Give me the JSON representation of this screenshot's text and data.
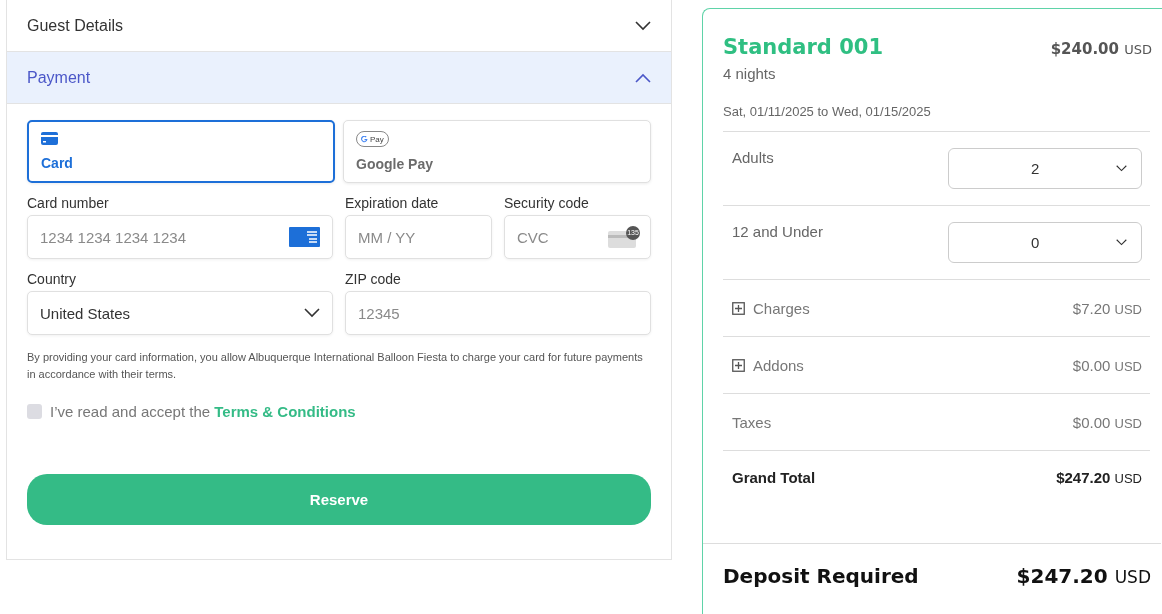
{
  "accordion": [
    {
      "title": "Guest Details",
      "expanded": false
    },
    {
      "title": "Payment",
      "expanded": true
    }
  ],
  "payment_methods": [
    {
      "label": "Card",
      "kind": "card",
      "selected": true
    },
    {
      "label": "Google Pay",
      "kind": "gpay",
      "logo_text": "Pay",
      "selected": false
    }
  ],
  "fields": [
    [
      {
        "label": "Card number",
        "kind": "card_number",
        "placeholder": "1234 1234 1234 1234"
      },
      {
        "label": "Expiration date",
        "kind": "expiry",
        "placeholder": "MM / YY"
      },
      {
        "label": "Security code",
        "kind": "cvc",
        "placeholder": "CVC",
        "icon_text": "135"
      }
    ],
    [
      {
        "label": "Country",
        "kind": "select",
        "value": "United States"
      },
      {
        "label": "ZIP code",
        "kind": "zip",
        "placeholder": "12345"
      }
    ]
  ],
  "consent": "By providing your card information, you allow Albuquerque International Balloon Fiesta to charge your card for future payments in accordance with their terms.",
  "terms": {
    "checked": false,
    "text": "I’ve read and accept the ",
    "link": "Terms & Conditions"
  },
  "reserve_button": "Reserve",
  "summary": {
    "room": "Standard 001",
    "price": "$240.00",
    "currency": "USD",
    "nights": "4 nights",
    "dates": "Sat, 01/11/2025 to Wed, 01/15/2025",
    "guests": [
      {
        "label": "Adults",
        "value": "2"
      },
      {
        "label": "12 and Under",
        "value": "0"
      }
    ],
    "lines": [
      {
        "kind": "expandable",
        "label": "Charges",
        "amount": "$7.20",
        "currency": "USD"
      },
      {
        "kind": "expandable",
        "label": "Addons",
        "amount": "$0.00",
        "currency": "USD"
      },
      {
        "kind": "plain",
        "label": "Taxes",
        "amount": "$0.00",
        "currency": "USD"
      },
      {
        "kind": "total",
        "label": "Grand Total",
        "amount": "$247.20",
        "currency": "USD"
      }
    ],
    "deposit": {
      "label": "Deposit Required",
      "amount": "$247.20",
      "currency": "USD"
    }
  }
}
